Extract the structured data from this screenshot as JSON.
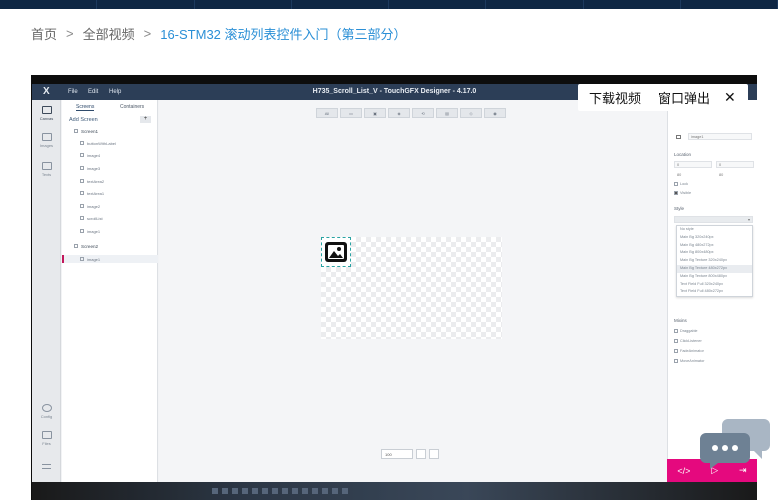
{
  "breadcrumb": {
    "home": "首页",
    "all_videos": "全部视频",
    "current": "16-STM32 滚动列表控件入门（第三部分）",
    "separator": ">"
  },
  "app": {
    "window_title": "H735_Scroll_List_V - TouchGFX Designer - 4.17.0",
    "menu": [
      "File",
      "Edit",
      "Help"
    ],
    "rail": [
      {
        "label": "Canvas",
        "icon": "canvas-icon"
      },
      {
        "label": "Images",
        "icon": "images-icon"
      },
      {
        "label": "Texts",
        "icon": "texts-icon"
      },
      {
        "label": "Config",
        "icon": "config-icon"
      },
      {
        "label": "Files",
        "icon": "files-icon"
      }
    ],
    "tree": {
      "tab_screens": "Screens",
      "tab_containers": "Containers",
      "add_screen": "Add Screen",
      "add_button": "+",
      "screen1": "Screen1",
      "screen1_children": [
        "buttonWithLabel",
        "image4",
        "image3",
        "textArea2",
        "textArea1",
        "image2",
        "scrollList",
        "image1"
      ],
      "screen2": "Screen2",
      "screen2_children": [
        "image1"
      ]
    },
    "toolbar": [
      "All",
      "▭",
      "▣",
      "◈",
      "⟲",
      "▤",
      "◇",
      "◉"
    ],
    "zoom_value": "100",
    "props": {
      "name_value": "image1",
      "location_label": "Location",
      "x_value": "0",
      "y_value": "0",
      "w_value": "80",
      "h_value": "80",
      "lock_label": "Lock",
      "visible_label": "Visible",
      "style_label": "Style",
      "style_options": [
        "No style",
        "Main Bg 320x240px",
        "Main Bg 480x272px",
        "Main Bg 800x480px",
        "Main Bg Texture 320x240px",
        "Main Bg Texture 480x272px",
        "Main Bg Texture 800x480px",
        "Text Field Full 320x240px",
        "Text Field Full 480x272px"
      ],
      "mixins_label": "Mixins",
      "mixins": [
        "Draggable",
        "ClickListener",
        "FadeAnimator",
        "MoveAnimator"
      ]
    },
    "actions": [
      "</>",
      "▷",
      "⇥"
    ]
  },
  "popup": {
    "download_label": "下载视频",
    "popout_label": "窗口弹出",
    "close_label": "✕"
  },
  "colors": {
    "link": "#2a8fd6",
    "topbar": "#0f2744",
    "menubar": "#2c3e57",
    "accent": "#e5097e"
  }
}
